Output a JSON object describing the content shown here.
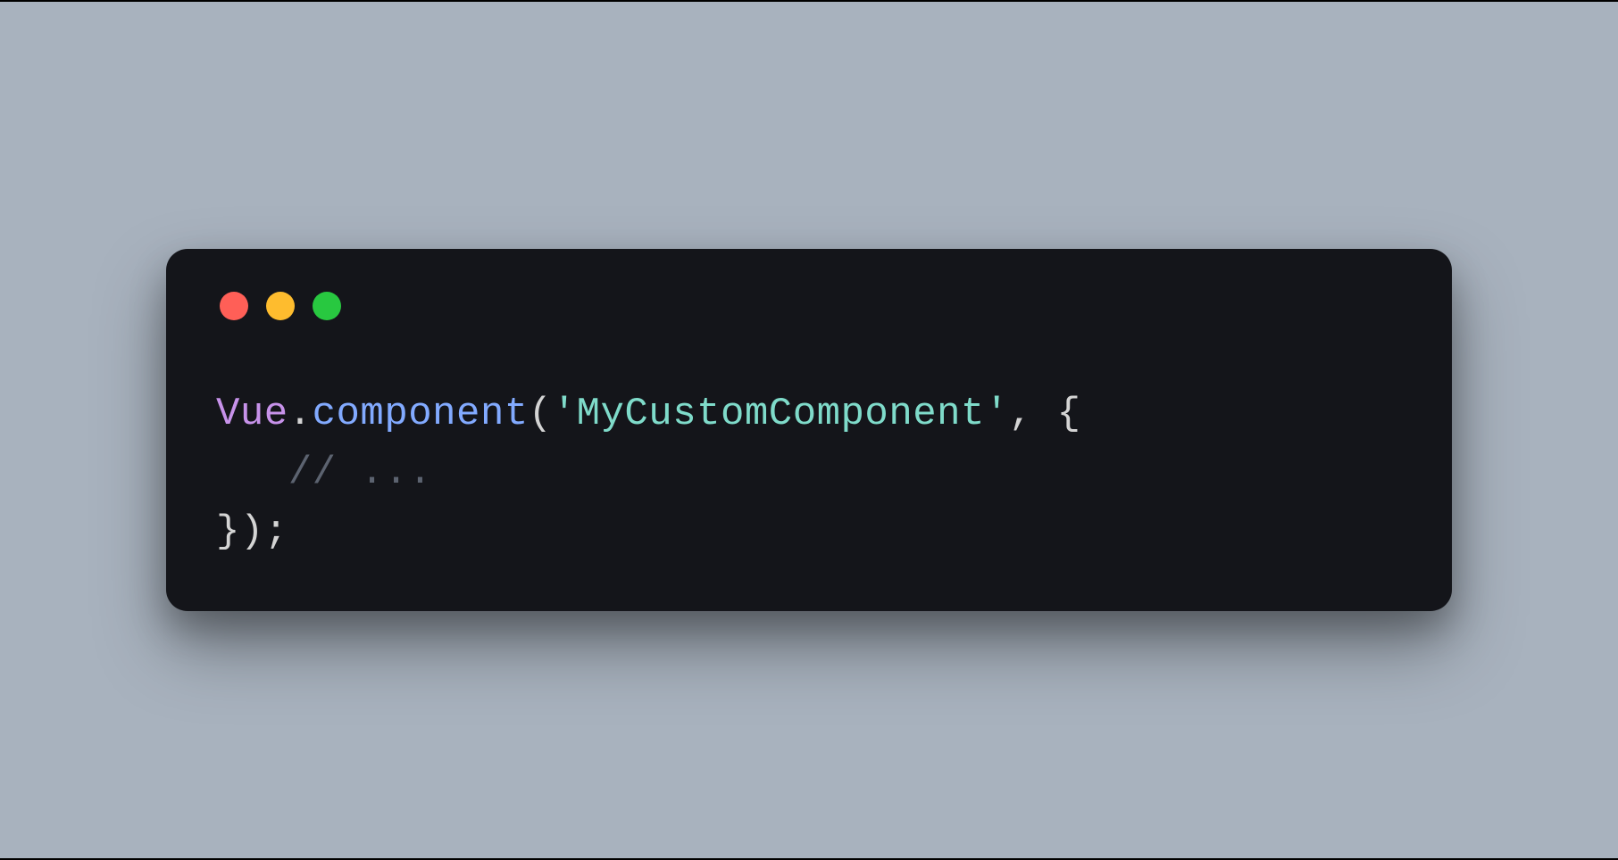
{
  "code": {
    "line1": {
      "class": "Vue",
      "dot": ".",
      "method": "component",
      "openParen": "(",
      "string": "'MyCustomComponent'",
      "comma": ", ",
      "openBrace": "{"
    },
    "line2": {
      "indent": "   ",
      "comment": "// ..."
    },
    "line3": {
      "closeBrace": "}",
      "closeParen": ")",
      "semicolon": ";"
    }
  },
  "colors": {
    "background": "#a8b2be",
    "windowBg": "#14151a",
    "red": "#ff5f57",
    "yellow": "#febc2e",
    "green": "#28c840",
    "class": "#c792ea",
    "method": "#82aaff",
    "string": "#7fdbca",
    "comment": "#5c6370",
    "punctuation": "#d4d4d4"
  }
}
